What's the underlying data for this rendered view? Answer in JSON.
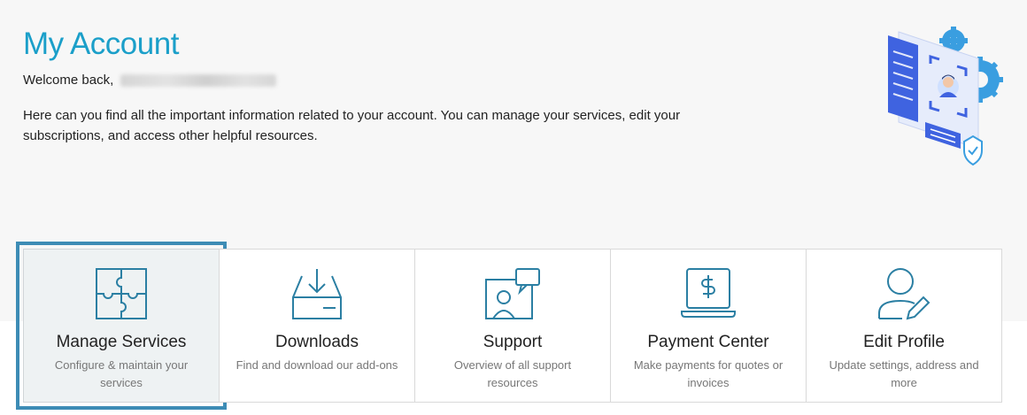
{
  "header": {
    "title": "My Account",
    "welcome_prefix": "Welcome back,",
    "intro": "Here can you find all the important information related to your account. You can manage your services, edit your subscriptions, and access other helpful resources."
  },
  "cards": [
    {
      "label": "Manage Services",
      "desc": "Configure & maintain your services",
      "icon": "puzzle-icon",
      "selected": true
    },
    {
      "label": "Downloads",
      "desc": "Find and download our add-ons",
      "icon": "download-tray-icon",
      "selected": false
    },
    {
      "label": "Support",
      "desc": "Overview of all support resources",
      "icon": "support-chat-icon",
      "selected": false
    },
    {
      "label": "Payment Center",
      "desc": "Make payments for quotes or invoices",
      "icon": "laptop-dollar-icon",
      "selected": false
    },
    {
      "label": "Edit Profile",
      "desc": "Update settings, address and more",
      "icon": "user-edit-icon",
      "selected": false
    }
  ],
  "colors": {
    "accent": "#1b9fc9",
    "icon_stroke": "#2b7fa3",
    "selection_outline": "#3d8cb5"
  }
}
